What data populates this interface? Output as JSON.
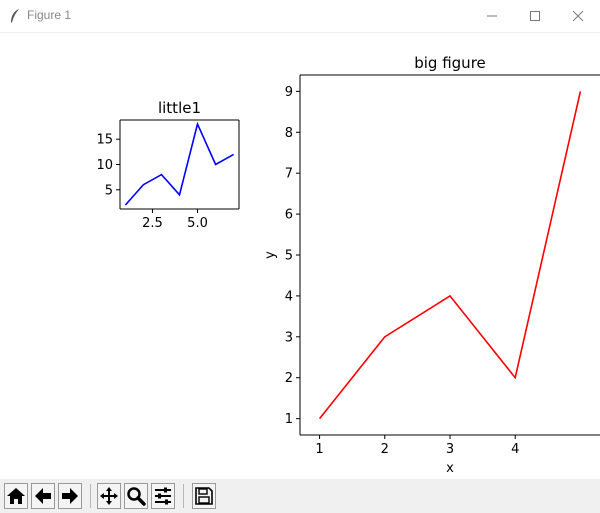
{
  "window": {
    "title": "Figure 1",
    "minimize_icon": "minimize-icon",
    "maximize_icon": "maximize-icon",
    "close_icon": "close-icon"
  },
  "chart_data": [
    {
      "type": "line",
      "title": "little1",
      "xlabel": "",
      "ylabel": "",
      "x": [
        1,
        2,
        3,
        4,
        5,
        6,
        7
      ],
      "series": [
        {
          "values": [
            2,
            6,
            8,
            4,
            18,
            10,
            12
          ],
          "color": "#0000ff"
        }
      ],
      "xticks": [
        2.5,
        5.0
      ],
      "xtick_labels": [
        "2.5",
        "5.0"
      ],
      "yticks": [
        5,
        10,
        15
      ],
      "ytick_labels": [
        "5",
        "10",
        "15"
      ],
      "xlim": [
        0.7,
        7.3
      ],
      "ylim": [
        1.2,
        18.8
      ],
      "grid": false
    },
    {
      "type": "line",
      "title": "big figure",
      "xlabel": "x",
      "ylabel": "y",
      "x": [
        1,
        2,
        3,
        4,
        5
      ],
      "series": [
        {
          "values": [
            1,
            3,
            4,
            2,
            9
          ],
          "color": "#ff0000"
        }
      ],
      "xticks": [
        1,
        2,
        3,
        4
      ],
      "xtick_labels": [
        "1",
        "2",
        "3",
        "4"
      ],
      "yticks": [
        1,
        2,
        3,
        4,
        5,
        6,
        7,
        8,
        9
      ],
      "ytick_labels": [
        "1",
        "2",
        "3",
        "4",
        "5",
        "6",
        "7",
        "8",
        "9"
      ],
      "xlim": [
        0.7,
        5.3
      ],
      "ylim": [
        0.6,
        9.4
      ],
      "grid": false
    }
  ],
  "toolbar": {
    "buttons": [
      {
        "name": "home",
        "icon": "home-icon"
      },
      {
        "name": "back",
        "icon": "arrow-left-icon"
      },
      {
        "name": "forward",
        "icon": "arrow-right-icon"
      },
      {
        "name": "pan",
        "icon": "move-icon"
      },
      {
        "name": "zoom",
        "icon": "magnifier-icon"
      },
      {
        "name": "configure-subplots",
        "icon": "sliders-icon"
      },
      {
        "name": "save",
        "icon": "floppy-disk-icon"
      }
    ]
  }
}
